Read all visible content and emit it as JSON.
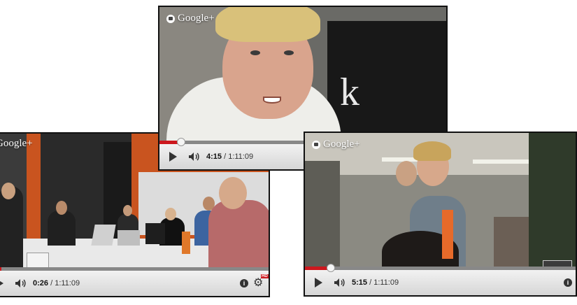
{
  "brand": {
    "label": "Google+",
    "icon": "hangouts-icon"
  },
  "colors": {
    "progress_played": "#cc181e",
    "controls_bg": "#e5e5e5"
  },
  "players": [
    {
      "id": "left",
      "time_current": "0:26",
      "time_total": "/ 1:11:09",
      "progress": 0.01
    },
    {
      "id": "top",
      "time_current": "4:15",
      "time_total": "/ 1:11:09",
      "progress": 0.06
    },
    {
      "id": "right",
      "time_current": "5:15",
      "time_total": "/ 1:11:09",
      "progress": 0.08
    }
  ],
  "video_text": {
    "letter": "k"
  }
}
